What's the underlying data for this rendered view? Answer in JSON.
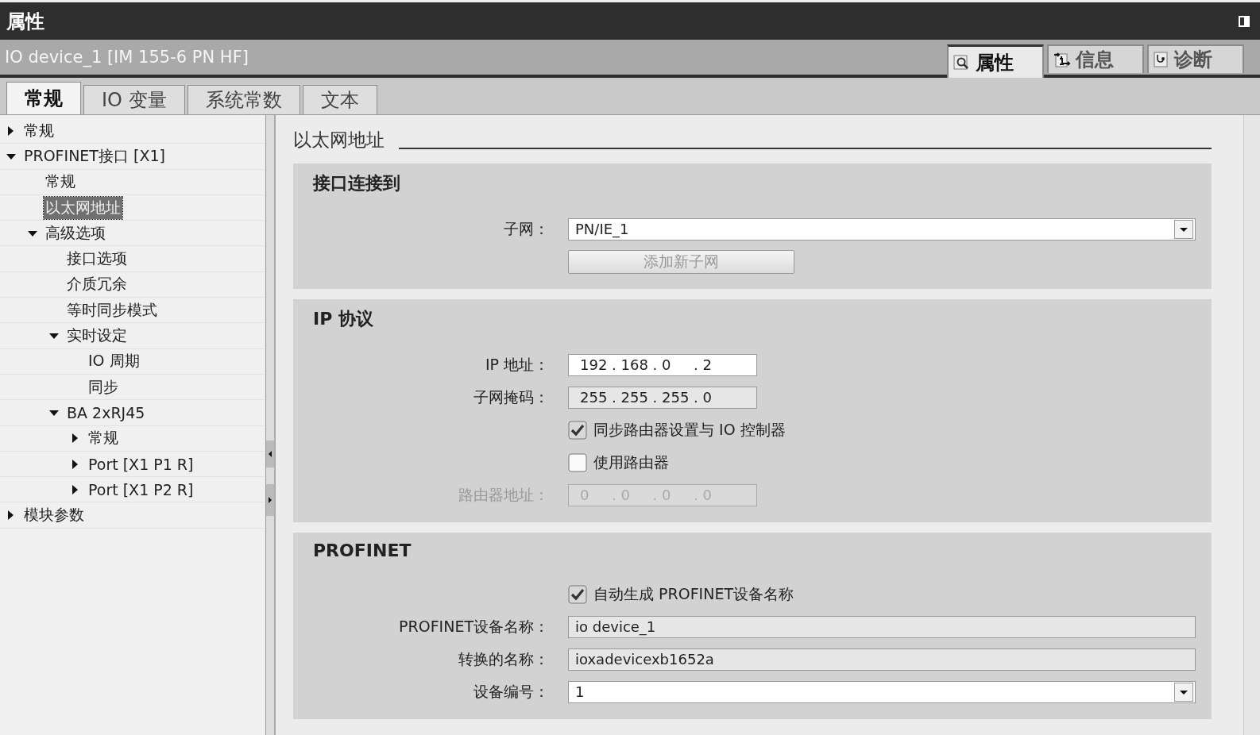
{
  "title_bar": {
    "title": "属性"
  },
  "object_bar": {
    "title": "IO device_1 [IM 155-6 PN HF]",
    "tabs": [
      {
        "label": "属性",
        "kind": "properties",
        "selected": true
      },
      {
        "label": "信息",
        "kind": "info",
        "selected": false
      },
      {
        "label": "诊断",
        "kind": "diagnostics",
        "selected": false
      }
    ]
  },
  "tabs": [
    {
      "label": "常规",
      "selected": true
    },
    {
      "label": "IO 变量",
      "selected": false
    },
    {
      "label": "系统常数",
      "selected": false
    },
    {
      "label": "文本",
      "selected": false
    }
  ],
  "tree": [
    {
      "label": "常规",
      "expanded": false,
      "selected": false
    },
    {
      "label": "PROFINET接口 [X1]",
      "expanded": true,
      "selected": false,
      "children": [
        {
          "label": "常规",
          "selected": false
        },
        {
          "label": "以太网地址",
          "selected": true
        },
        {
          "label": "高级选项",
          "expanded": true,
          "selected": false,
          "children": [
            {
              "label": "接口选项",
              "selected": false
            },
            {
              "label": "介质冗余",
              "selected": false
            },
            {
              "label": "等时同步模式",
              "selected": false
            },
            {
              "label": "实时设定",
              "expanded": true,
              "selected": false,
              "children": [
                {
                  "label": "IO 周期",
                  "selected": false
                },
                {
                  "label": "同步",
                  "selected": false
                }
              ]
            },
            {
              "label": "BA 2xRJ45",
              "expanded": true,
              "selected": false,
              "children": [
                {
                  "label": "常规",
                  "expanded": false,
                  "selected": false
                },
                {
                  "label": "Port [X1 P1 R]",
                  "expanded": false,
                  "selected": false
                },
                {
                  "label": "Port [X1 P2 R]",
                  "expanded": false,
                  "selected": false
                }
              ]
            }
          ]
        }
      ]
    },
    {
      "label": "模块参数",
      "expanded": false,
      "selected": false
    }
  ],
  "content": {
    "heading": "以太网地址",
    "sections": [
      {
        "title": "接口连接到",
        "rows": [
          {
            "kind": "dropdown",
            "label": "子网：",
            "value": "PN/IE_1",
            "disabled": false
          },
          {
            "kind": "button",
            "label": "添加新子网",
            "disabled": true
          }
        ]
      },
      {
        "title": "IP 协议",
        "rows": [
          {
            "kind": "ip",
            "label": "IP 地址：",
            "value": "192 . 168 . 0     . 2",
            "disabled": false
          },
          {
            "kind": "ip",
            "label": "子网掩码：",
            "value": "255 . 255 . 255 . 0",
            "disabled": false,
            "readonly": true
          },
          {
            "kind": "checkbox",
            "label": "同步路由器设置与 IO 控制器",
            "checked": true
          },
          {
            "kind": "checkbox",
            "label": "使用路由器",
            "checked": false
          },
          {
            "kind": "ip",
            "label": "路由器地址：",
            "value": "0     . 0     . 0     . 0",
            "disabled": true
          }
        ]
      },
      {
        "title": "PROFINET",
        "rows": [
          {
            "kind": "checkbox",
            "label": "自动生成 PROFINET设备名称",
            "checked": true
          },
          {
            "kind": "text",
            "label": "PROFINET设备名称：",
            "value": "io device_1",
            "disabled": false,
            "readonly": true
          },
          {
            "kind": "text",
            "label": "转换的名称：",
            "value": "ioxadevicexb1652a",
            "disabled": false,
            "readonly": true
          },
          {
            "kind": "dropdown",
            "label": "设备编号：",
            "value": "1",
            "disabled": false
          }
        ]
      }
    ]
  }
}
